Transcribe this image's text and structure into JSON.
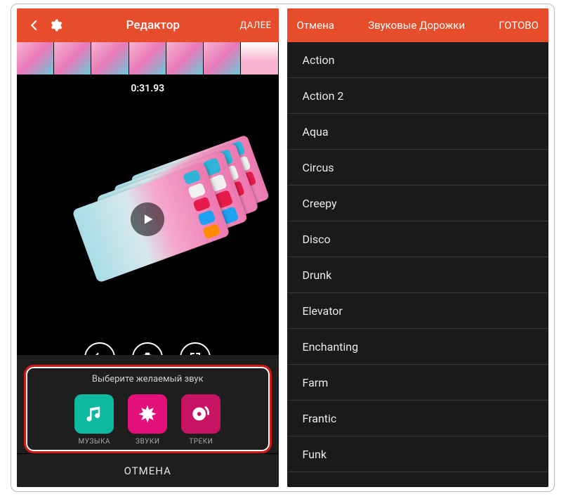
{
  "left": {
    "header": {
      "title": "Редактор",
      "next": "ДАЛЕЕ"
    },
    "timecode": "0:31.93",
    "soundSheet": {
      "title": "Выберите желаемый звук",
      "options": [
        {
          "label": "МУЗЫКА",
          "kind": "music"
        },
        {
          "label": "ЗВУКИ",
          "kind": "sounds"
        },
        {
          "label": "ТРЕКИ",
          "kind": "tracks"
        }
      ],
      "cancel": "ОТМЕНА"
    }
  },
  "right": {
    "header": {
      "cancel": "Отмена",
      "title": "Звуковые Дорожки",
      "done": "ГОТОВО"
    },
    "tracks": [
      "Action",
      "Action 2",
      "Aqua",
      "Circus",
      "Creepy",
      "Disco",
      "Drunk",
      "Elevator",
      "Enchanting",
      "Farm",
      "Frantic",
      "Funk"
    ]
  }
}
